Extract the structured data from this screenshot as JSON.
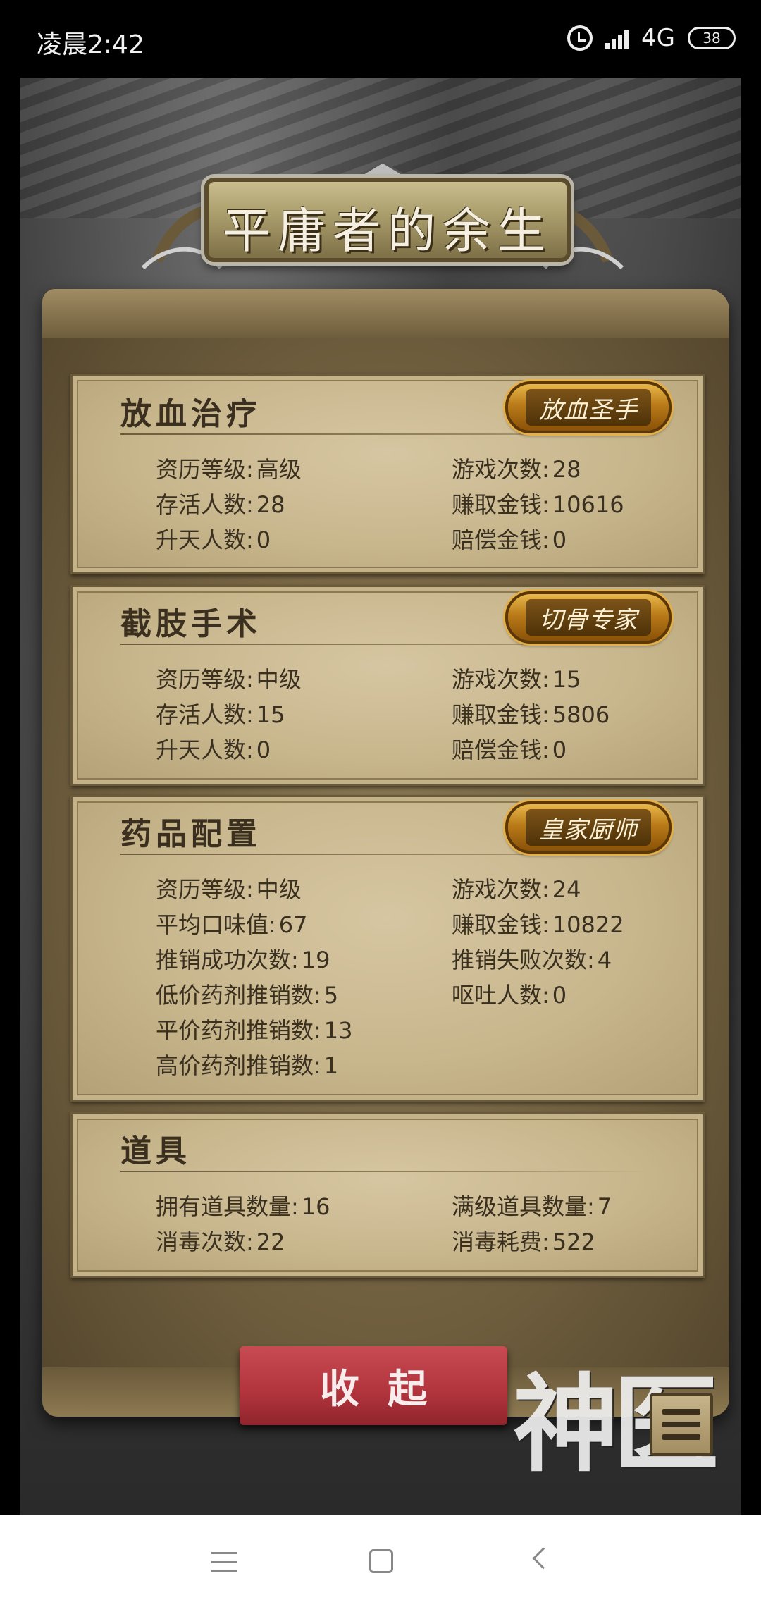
{
  "status_bar": {
    "time": "凌晨2:42",
    "network": "4G",
    "battery": "38"
  },
  "banner": {
    "title": "平庸者的余生"
  },
  "sections": [
    {
      "title": "放血治疗",
      "badge": "放血圣手",
      "stats": [
        {
          "label": "资历等级:",
          "value": "高级"
        },
        {
          "label": "游戏次数:",
          "value": "28"
        },
        {
          "label": "存活人数:",
          "value": "28"
        },
        {
          "label": "赚取金钱:",
          "value": "10616"
        },
        {
          "label": "升天人数:",
          "value": "0"
        },
        {
          "label": "赔偿金钱:",
          "value": "0"
        }
      ]
    },
    {
      "title": "截肢手术",
      "badge": "切骨专家",
      "stats": [
        {
          "label": "资历等级:",
          "value": "中级"
        },
        {
          "label": "游戏次数:",
          "value": "15"
        },
        {
          "label": "存活人数:",
          "value": "15"
        },
        {
          "label": "赚取金钱:",
          "value": "5806"
        },
        {
          "label": "升天人数:",
          "value": "0"
        },
        {
          "label": "赔偿金钱:",
          "value": "0"
        }
      ]
    },
    {
      "title": "药品配置",
      "badge": "皇家厨师",
      "stats": [
        {
          "label": "资历等级:",
          "value": "中级"
        },
        {
          "label": "游戏次数:",
          "value": "24"
        },
        {
          "label": "平均口味值:",
          "value": "67"
        },
        {
          "label": "赚取金钱:",
          "value": "10822"
        },
        {
          "label": "推销成功次数:",
          "value": "19"
        },
        {
          "label": "推销失败次数:",
          "value": "4"
        },
        {
          "label": "低价药剂推销数:",
          "value": "5"
        },
        {
          "label": "呕吐人数:",
          "value": "0"
        },
        {
          "label": "平价药剂推销数:",
          "value": "13"
        },
        {
          "label": "高价药剂推销数:",
          "value": "1"
        }
      ]
    },
    {
      "title": "道具",
      "stats": [
        {
          "label": "拥有道具数量:",
          "value": "16"
        },
        {
          "label": "满级道具数量:",
          "value": "7"
        },
        {
          "label": "消毒次数:",
          "value": "22"
        },
        {
          "label": "消毒耗费:",
          "value": "522"
        }
      ]
    }
  ],
  "collapse_button": "收起",
  "logo_text": "神医",
  "icons": {
    "alarm": "alarm-icon",
    "signal": "signal-icon",
    "battery": "battery-icon",
    "menu": "menu-list-icon",
    "nav_menu": "nav-recents-icon",
    "nav_home": "nav-home-icon",
    "nav_back": "nav-back-icon"
  }
}
